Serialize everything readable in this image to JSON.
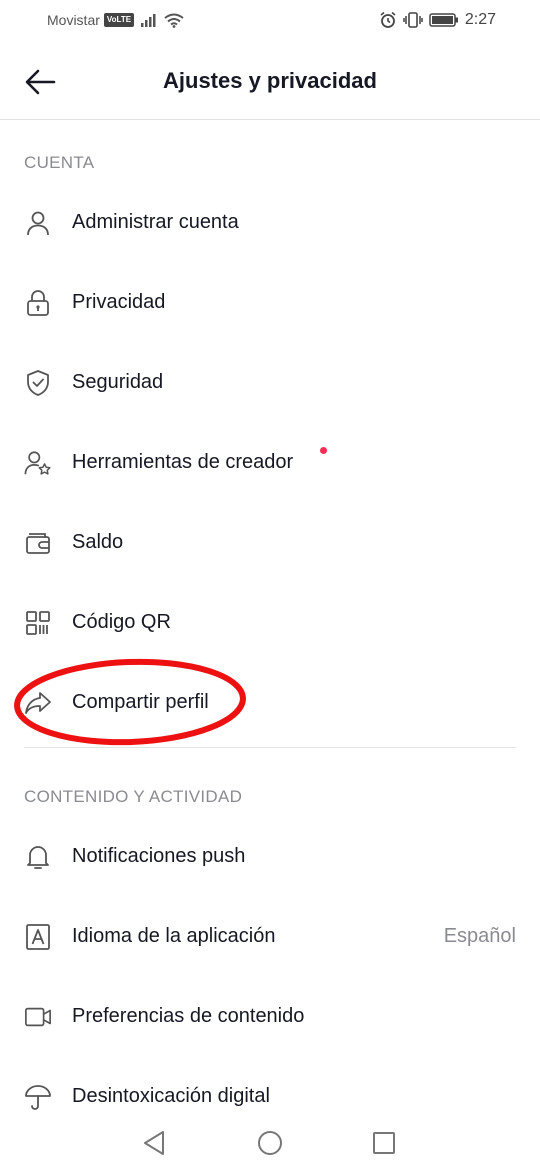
{
  "status_bar": {
    "carrier": "Movistar",
    "volte": "VoLTE",
    "time": "2:27",
    "icons": [
      "signal-icon",
      "wifi-icon",
      "alarm-icon",
      "vibrate-icon",
      "battery-icon"
    ]
  },
  "header": {
    "title": "Ajustes y privacidad"
  },
  "sections": {
    "account": {
      "title": "CUENTA",
      "items": [
        {
          "label": "Administrar cuenta",
          "icon": "person-icon"
        },
        {
          "label": "Privacidad",
          "icon": "lock-icon"
        },
        {
          "label": "Seguridad",
          "icon": "shield-icon"
        },
        {
          "label": "Herramientas de creador",
          "icon": "creator-star-icon",
          "badge": true
        },
        {
          "label": "Saldo",
          "icon": "wallet-icon"
        },
        {
          "label": "Código QR",
          "icon": "qr-code-icon"
        },
        {
          "label": "Compartir perfil",
          "icon": "share-arrow-icon"
        }
      ]
    },
    "content": {
      "title": "CONTENIDO Y ACTIVIDAD",
      "items": [
        {
          "label": "Notificaciones push",
          "icon": "bell-icon"
        },
        {
          "label": "Idioma de la aplicación",
          "icon": "language-icon",
          "value": "Español"
        },
        {
          "label": "Preferencias de contenido",
          "icon": "video-camera-icon"
        },
        {
          "label": "Desintoxicación digital",
          "icon": "umbrella-icon"
        }
      ]
    }
  },
  "colors": {
    "text": "#161823",
    "muted": "#8a8b91",
    "badge": "#fe2c55",
    "annotation": "#ee1111"
  },
  "nav_bar": {
    "icons": [
      "back-triangle-icon",
      "home-circle-icon",
      "recents-square-icon"
    ]
  }
}
